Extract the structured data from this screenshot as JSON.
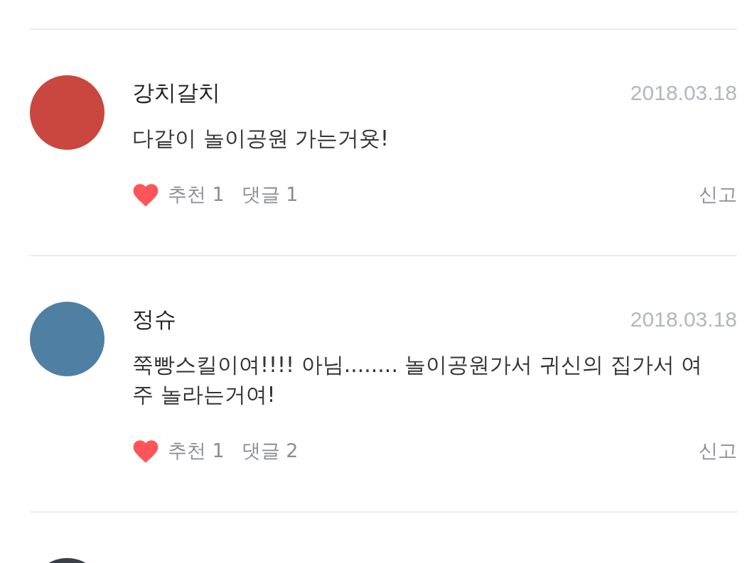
{
  "comments": [
    {
      "author": "강치갈치",
      "date": "2018.03.18",
      "text": "다같이 놀이공원 가는거욧!",
      "likes": "추천 1",
      "replies": "댓글 1",
      "report": "신고"
    },
    {
      "author": "정슈",
      "date": "2018.03.18",
      "text": "쭉빵스킬이여!!!! 아님........ 놀이공원가서 귀신의 집가서 여주 놀라는거여!",
      "likes": "추천 1",
      "replies": "댓글 2",
      "report": "신고"
    }
  ]
}
